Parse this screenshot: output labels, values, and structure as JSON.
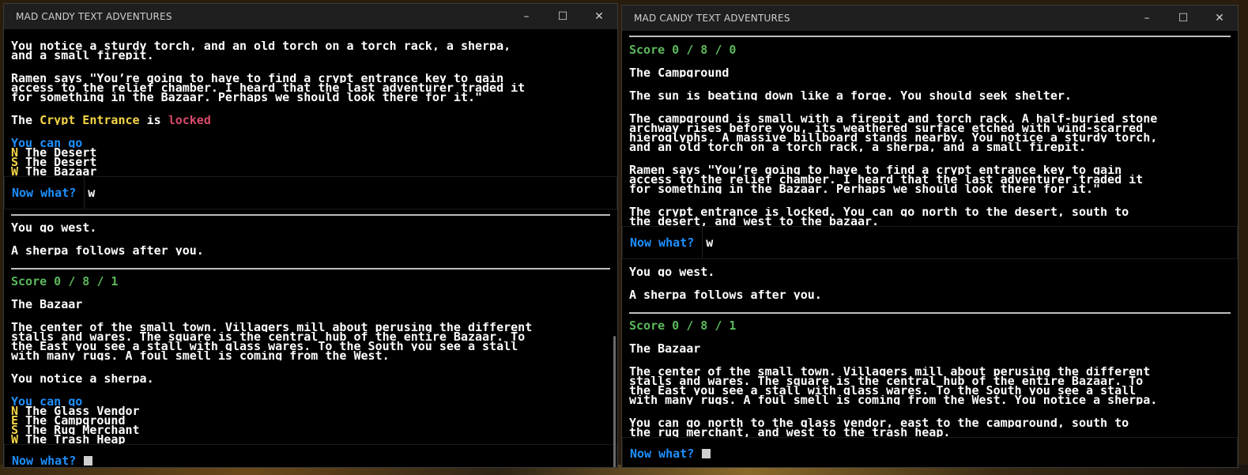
{
  "left": {
    "title": "MAD CANDY TEXT ADVENTURES",
    "lines_top": [
      "You notice a sturdy torch, and an old torch on a torch rack, a sherpa,",
      "and a small firepit."
    ],
    "ramen": [
      "Ramen says \"You’re going to have to find a crypt entrance key to gain",
      "access to the relief chamber. I heard that the last adventurer traded it",
      "for something in the Bazaar. Perhaps we should look there for it.\""
    ],
    "crypt": {
      "pre": "The ",
      "name": "Crypt Entrance",
      "mid": " is ",
      "state": "locked"
    },
    "exits_label": "You can go",
    "exits1": [
      {
        "k": "N",
        "v": " The Desert"
      },
      {
        "k": "S",
        "v": " The Desert"
      },
      {
        "k": "W",
        "v": " The Bazaar"
      }
    ],
    "prompt1": {
      "label": "Now what?",
      "cmd": "w"
    },
    "go_west": "You go west.",
    "sherpa_follows": "A sherpa follows after you.",
    "score": "Score 0 / 8 / 1",
    "room": "The Bazaar",
    "desc": [
      "The center of the small town. Villagers mill about perusing the different",
      "stalls and wares. The square is the central hub of the entire Bazaar. To",
      "the East you see a stall with glass wares. To the South you see a stall",
      "with many rugs. A foul smell is coming from the West."
    ],
    "notice": "You notice a sherpa.",
    "exits2": [
      {
        "k": "N",
        "v": " The Glass Vendor"
      },
      {
        "k": "E",
        "v": " The Campground"
      },
      {
        "k": "S",
        "v": " The Rug Merchant"
      },
      {
        "k": "W",
        "v": " The Trash Heap"
      }
    ],
    "prompt2": {
      "label": "Now what?"
    }
  },
  "right": {
    "title": "MAD CANDY TEXT ADVENTURES",
    "score1": "Score 0 / 8 / 0",
    "room1": "The Campground",
    "sun": "The sun is beating down like a forge. You should seek shelter.",
    "desc1": [
      "The campground is small with a firepit and torch rack. A half-buried stone",
      "archway rises before you, its weathered surface etched with wind-scarred",
      "hieroglyphs. A massive billboard stands nearby. You notice a sturdy torch,",
      "and an old torch on a torch rack, a sherpa, and a small firepit."
    ],
    "ramen": [
      "Ramen says \"You’re going to have to find a crypt entrance key to gain",
      "access to the relief chamber. I heard that the last adventurer traded it",
      "for something in the Bazaar. Perhaps we should look there for it.\""
    ],
    "crypt": [
      "The crypt entrance is locked. You can go north to the desert, south to",
      "the desert, and west to the bazaar."
    ],
    "prompt1": {
      "label": "Now what?",
      "cmd": "w"
    },
    "go_west": "You go west.",
    "sherpa_follows": "A sherpa follows after you.",
    "score2": "Score 0 / 8 / 1",
    "room2": "The Bazaar",
    "desc2": [
      "The center of the small town. Villagers mill about perusing the different",
      "stalls and wares. The square is the central hub of the entire Bazaar. To",
      "the East you see a stall with glass wares. To the South you see a stall",
      "with many rugs. A foul smell is coming from the West. You notice a sherpa."
    ],
    "exits": [
      "You can go north to the glass vendor, east to the campground, south to",
      "the rug merchant, and west to the trash heap."
    ],
    "prompt2": {
      "label": "Now what?"
    }
  },
  "window_controls": {
    "minimize": "–",
    "maximize": "☐",
    "close": "✕"
  }
}
